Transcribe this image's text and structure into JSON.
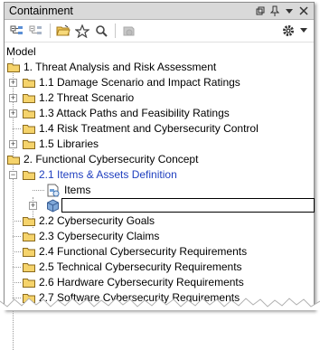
{
  "panel": {
    "title": "Containment"
  },
  "toolbar": {
    "icons": [
      "collapse-all-icon",
      "expand-all-icon",
      "open-folder-icon",
      "favorite-star-icon",
      "search-icon",
      "sync-icon",
      "gear-icon",
      "dropdown-arrow-icon"
    ]
  },
  "tree": {
    "root": "Model",
    "n1": "1. Threat Analysis and Risk Assessment",
    "n1_1": "1.1 Damage Scenario and Impact Ratings",
    "n1_2": "1.2 Threat Scenario",
    "n1_3": "1.3 Attack Paths and Feasibility Ratings",
    "n1_4": "1.4 Risk Treatment and Cybersecurity Control",
    "n1_5": "1.5 Libraries",
    "n2": "2. Functional Cybersecurity Concept",
    "n2_1": "2.1 Items & Assets Definition",
    "n2_1_a": "Items",
    "n2_1_b": "",
    "n2_2": "2.2 Cybersecurity Goals",
    "n2_3": "2.3 Cybersecurity Claims",
    "n2_4": "2.4 Functional Cybersecurity Requirements",
    "n2_5": "2.5 Technical Cybersecurity Requirements",
    "n2_6": "2.6 Hardware Cybersecurity Requirements",
    "n2_7": "2.7 Software Cybersecurity Requirements"
  },
  "colors": {
    "selected_text": "#1f3fbf",
    "titlebar": "#d9d9d9",
    "folder": "#f5d36b"
  }
}
